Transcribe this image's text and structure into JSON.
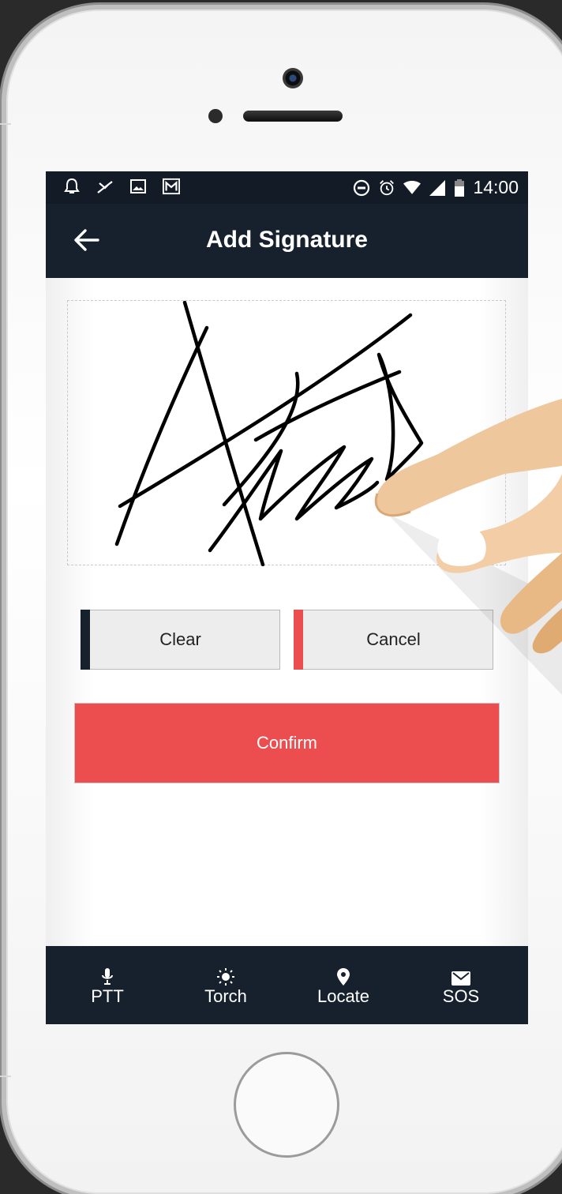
{
  "status_bar": {
    "time": "14:00",
    "left_icons": [
      "bell-icon",
      "missed-call-icon",
      "image-icon",
      "gmail-icon"
    ],
    "right_icons": [
      "do-not-disturb-icon",
      "alarm-icon",
      "wifi-icon",
      "signal-icon",
      "battery-icon"
    ]
  },
  "app_bar": {
    "title": "Add Signature",
    "back_icon": "arrow-left-icon"
  },
  "signature_pad": {
    "has_signature": true
  },
  "buttons": {
    "clear": "Clear",
    "cancel": "Cancel",
    "confirm": "Confirm"
  },
  "colors": {
    "navy": "#17212e",
    "accent_red": "#ec4e50",
    "clear_bar": "#17212e",
    "cancel_bar": "#ec4e50"
  },
  "bottom_nav": [
    {
      "label": "PTT",
      "icon": "microphone-icon"
    },
    {
      "label": "Torch",
      "icon": "sun-icon"
    },
    {
      "label": "Locate",
      "icon": "location-pin-icon"
    },
    {
      "label": "SOS",
      "icon": "envelope-icon"
    }
  ]
}
